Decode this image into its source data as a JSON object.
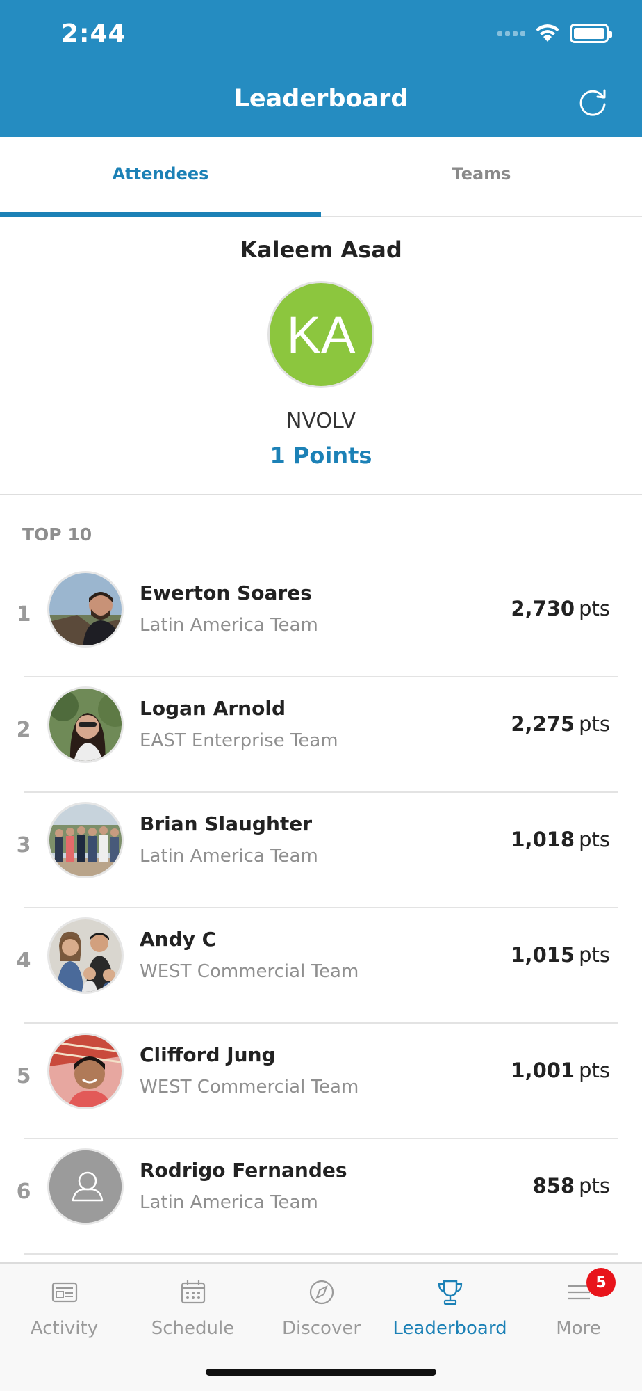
{
  "status_bar": {
    "time": "2:44"
  },
  "header": {
    "title": "Leaderboard"
  },
  "tabs": [
    {
      "label": "Attendees",
      "active": true
    },
    {
      "label": "Teams",
      "active": false
    }
  ],
  "profile": {
    "name": "Kaleem Asad",
    "initials": "KA",
    "organization": "NVOLV",
    "points": "1 Points",
    "avatar_color": "#8cc63e"
  },
  "top10": {
    "label": "TOP 10",
    "entries": [
      {
        "rank": "1",
        "name": "Ewerton Soares",
        "team": "Latin America Team",
        "points": "2,730",
        "unit": "pts",
        "avatar": "photo"
      },
      {
        "rank": "2",
        "name": "Logan Arnold",
        "team": "EAST Enterprise Team",
        "points": "2,275",
        "unit": "pts",
        "avatar": "photo"
      },
      {
        "rank": "3",
        "name": "Brian Slaughter",
        "team": "Latin America Team",
        "points": "1,018",
        "unit": "pts",
        "avatar": "photo"
      },
      {
        "rank": "4",
        "name": "Andy C",
        "team": "WEST Commercial Team",
        "points": "1,015",
        "unit": "pts",
        "avatar": "photo"
      },
      {
        "rank": "5",
        "name": "Clifford Jung",
        "team": "WEST Commercial Team",
        "points": "1,001",
        "unit": "pts",
        "avatar": "photo"
      },
      {
        "rank": "6",
        "name": "Rodrigo Fernandes",
        "team": "Latin America Team",
        "points": "858",
        "unit": "pts",
        "avatar": "placeholder-user-icon"
      }
    ]
  },
  "bottom_nav": [
    {
      "label": "Activity",
      "icon": "activity-icon",
      "active": false
    },
    {
      "label": "Schedule",
      "icon": "calendar-icon",
      "active": false
    },
    {
      "label": "Discover",
      "icon": "compass-icon",
      "active": false
    },
    {
      "label": "Leaderboard",
      "icon": "trophy-icon",
      "active": true
    },
    {
      "label": "More",
      "icon": "menu-icon",
      "active": false,
      "badge": "5"
    }
  ],
  "colors": {
    "brand": "#258cc1",
    "accent": "#1c81b6",
    "badge": "#e8141b"
  }
}
